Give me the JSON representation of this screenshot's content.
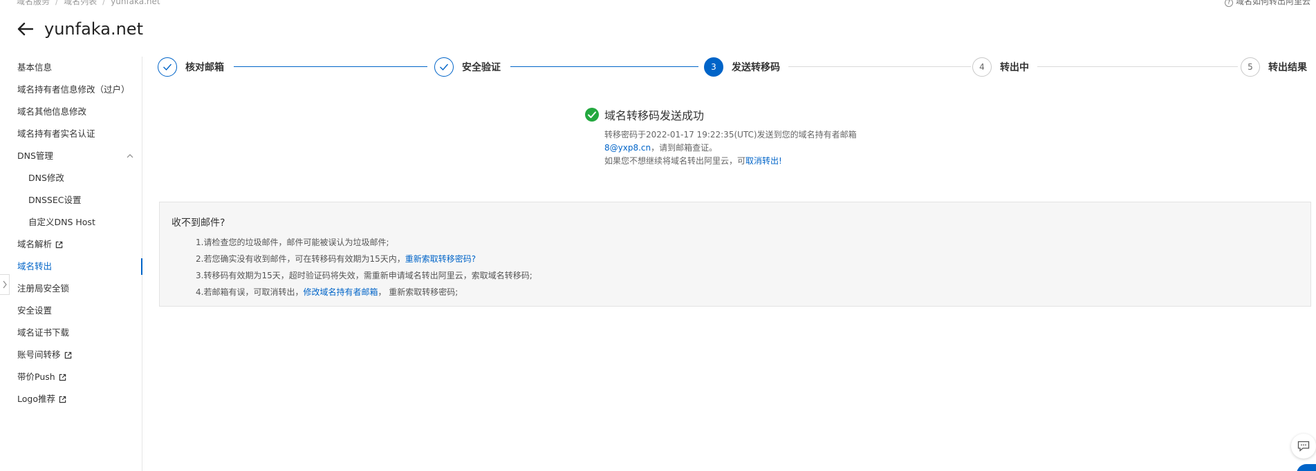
{
  "breadcrumb": [
    "域名服务",
    "域名列表",
    "yunfaka.net"
  ],
  "help": {
    "label": "域名如何转出阿里云"
  },
  "header": {
    "title": "yunfaka.net"
  },
  "sidebar": {
    "items": [
      {
        "label": "基本信息"
      },
      {
        "label": "域名持有者信息修改（过户）"
      },
      {
        "label": "域名其他信息修改"
      },
      {
        "label": "域名持有者实名认证"
      },
      {
        "label": "DNS管理"
      },
      {
        "label": "DNS修改"
      },
      {
        "label": "DNSSEC设置"
      },
      {
        "label": "自定义DNS Host"
      },
      {
        "label": "域名解析"
      },
      {
        "label": "域名转出"
      },
      {
        "label": "注册局安全锁"
      },
      {
        "label": "安全设置"
      },
      {
        "label": "域名证书下载"
      },
      {
        "label": "账号间转移"
      },
      {
        "label": "带价Push"
      },
      {
        "label": "Logo推荐"
      }
    ]
  },
  "steps": [
    {
      "number": "1",
      "label": "核对邮箱",
      "status": "done"
    },
    {
      "number": "2",
      "label": "安全验证",
      "status": "done"
    },
    {
      "number": "3",
      "label": "发送转移码",
      "status": "current"
    },
    {
      "number": "4",
      "label": "转出中",
      "status": "todo"
    },
    {
      "number": "5",
      "label": "转出结果",
      "status": "todo"
    }
  ],
  "result": {
    "title": "域名转移码发送成功",
    "line1": "转移密码于2022-01-17 19:22:35(UTC)发送到您的域名持有者邮箱",
    "email": "8@yxp8.cn",
    "line2_suffix": "，请到邮箱查证。",
    "line3_prefix": "如果您不想继续将域名转出阿里云，可",
    "cancel_link": "取消转出!"
  },
  "tips": {
    "title": "收不到邮件?",
    "item1": "1.请检查您的垃圾邮件，邮件可能被误认为垃圾邮件;",
    "item2_prefix": "2.若您确实没有收到邮件，可在转移码有效期为15天内，",
    "item2_link": "重新索取转移密码?",
    "item3": "3.转移码有效期为15天，超时验证码将失效，需重新申请域名转出阿里云，索取域名转移码;",
    "item4_prefix": "4.若邮箱有误，可取消转出，",
    "item4_link": "修改域名持有者邮箱",
    "item4_suffix": "， 重新索取转移密码;"
  },
  "colors": {
    "primary": "#0064c8",
    "success": "#23a83f"
  }
}
